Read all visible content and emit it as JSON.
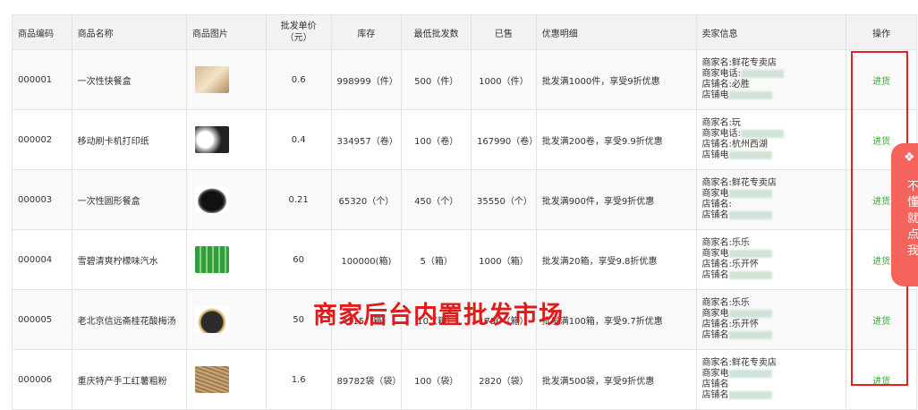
{
  "columns": [
    "商品编码",
    "商品名称",
    "商品图片",
    "批发单价\n（元）",
    "库存",
    "最低批发数",
    "已售",
    "优惠明细",
    "卖家信息",
    "操作"
  ],
  "rows": [
    {
      "code": "000001",
      "name": "一次性快餐盒",
      "price": "0.6",
      "stock": "998999（件）",
      "min": "500（件）",
      "sold": "1000（件）",
      "promo": "批发满1000件，享受9折优惠",
      "seller": [
        "商家名:鲜花专卖店",
        "商家电话:",
        "店铺名:必胜",
        "店铺电"
      ],
      "action": "进货",
      "img": "packaging-image"
    },
    {
      "code": "000002",
      "name": "移动刷卡机打印纸",
      "price": "0.4",
      "stock": "334957（卷）",
      "min": "100（卷）",
      "sold": "167990（卷）",
      "promo": "批发满200卷，享受9.9折优惠",
      "seller": [
        "商家名:玩",
        "商家电话:",
        "店铺名:杭州西湖",
        "店铺电"
      ],
      "action": "进货",
      "img": "paper-roll-image"
    },
    {
      "code": "000003",
      "name": "一次性圆形餐盒",
      "price": "0.21",
      "stock": "65320（个）",
      "min": "450（个）",
      "sold": "35550（个）",
      "promo": "批发满900件，享受9折优惠",
      "seller": [
        "商家名:鲜花专卖店",
        "商家电",
        "店铺名:",
        "店铺名"
      ],
      "action": "进货",
      "img": "bowl-image"
    },
    {
      "code": "000004",
      "name": "雪碧清爽柠檬味汽水",
      "price": "60",
      "stock": "100000(箱)",
      "min": "5（箱）",
      "sold": "1000（箱）",
      "promo": "批发满20箱，享受9.8折优惠",
      "seller": [
        "商家名:乐乐",
        "商家电",
        "店铺名:乐开怀",
        "店铺名"
      ],
      "action": "进货",
      "img": "bottles-image"
    },
    {
      "code": "000005",
      "name": "老北京信远斋桂花酸梅汤",
      "price": "50",
      "stock": "4115（箱）",
      "min": "10（箱）",
      "sold": "1790（箱）",
      "promo": "批发满100箱，享受9.7折优惠",
      "seller": [
        "商家名:乐乐",
        "商家电",
        "店铺名:乐开怀",
        "店铺名"
      ],
      "action": "进货",
      "img": "jar-image"
    },
    {
      "code": "000006",
      "name": "重庆特产手工红薯粗粉",
      "price": "1.6",
      "stock": "89782袋（袋）",
      "min": "100（袋）",
      "sold": "2820（袋）",
      "promo": "批发满500袋，享受9折优惠",
      "seller": [
        "商家名:鲜花专卖店",
        "商家电",
        "店铺名",
        "店铺名"
      ],
      "action": "进货",
      "img": "noodles-image"
    }
  ],
  "overlay_text": "商家后台内置批发市场",
  "side_tab": {
    "text": "不懂就点我"
  },
  "colors": {
    "overlay": "#e01b1b",
    "action": "#3aa63a",
    "side_tab": "#f4635c",
    "redbox": "#e32222"
  }
}
